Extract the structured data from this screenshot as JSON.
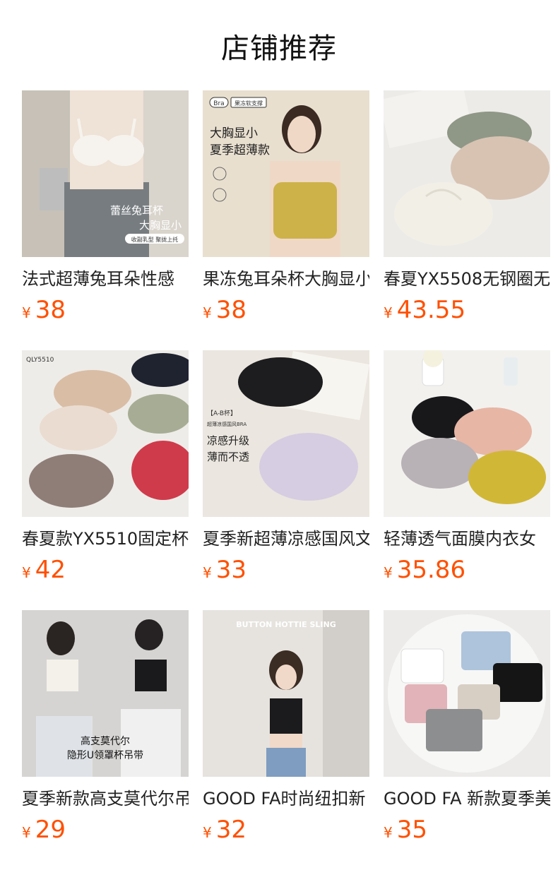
{
  "header": {
    "title": "店铺推荐"
  },
  "products": [
    {
      "name": "法式超薄兔耳朵性感",
      "currency": "¥",
      "price": "38",
      "overlay": [
        "蕾丝兔耳杯",
        "大胸显小",
        "收副乳型 聚拢上托"
      ]
    },
    {
      "name": "果冻兔耳朵杯大胸显小",
      "currency": "¥",
      "price": "38",
      "overlay": [
        "Bra",
        "果冻软支撑",
        "大胸显小",
        "夏季超薄款"
      ]
    },
    {
      "name": "春夏YX5508无钢圈无",
      "currency": "¥",
      "price": "43.55",
      "overlay": []
    },
    {
      "name": "春夏款YX5510固定杯",
      "currency": "¥",
      "price": "42",
      "overlay": [
        "QLY5510"
      ]
    },
    {
      "name": "夏季新超薄凉感国风文",
      "currency": "¥",
      "price": "33",
      "overlay": [
        "【A-B杯】",
        "超薄凉感国风BRA",
        "凉感升级",
        "薄而不透"
      ]
    },
    {
      "name": "轻薄透气面膜内衣女",
      "currency": "¥",
      "price": "35.86",
      "overlay": []
    },
    {
      "name": "夏季新款高支莫代尔吊",
      "currency": "¥",
      "price": "29",
      "overlay": [
        "高支莫代尔",
        "隐形U领罩杯吊带"
      ]
    },
    {
      "name": "GOOD FA时尚纽扣新",
      "currency": "¥",
      "price": "32",
      "overlay": [
        "BUTTON HOTTIE SLING"
      ]
    },
    {
      "name": "GOOD FA 新款夏季美",
      "currency": "¥",
      "price": "35",
      "overlay": []
    }
  ]
}
